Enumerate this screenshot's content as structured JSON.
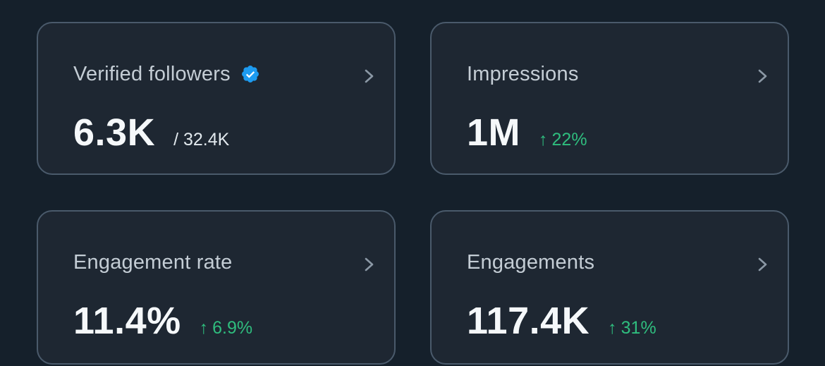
{
  "cards": [
    {
      "label": "Verified followers",
      "value": "6.3K",
      "total": "/ 32.4K",
      "verified_badge_icon": "verified-check-badge",
      "chevron_icon": "chevron-right"
    },
    {
      "label": "Impressions",
      "value": "1M",
      "delta_arrow": "↑",
      "delta": "22%",
      "chevron_icon": "chevron-right"
    },
    {
      "label": "Engagement rate",
      "value": "11.4%",
      "delta_arrow": "↑",
      "delta": "6.9%",
      "chevron_icon": "chevron-right"
    },
    {
      "label": "Engagements",
      "value": "117.4K",
      "delta_arrow": "↑",
      "delta": "31%",
      "chevron_icon": "chevron-right"
    }
  ],
  "colors": {
    "background": "#15202b",
    "card_background": "#1e2732",
    "card_border": "#4a5a6b",
    "verified_blue": "#1d9bf0",
    "positive_green": "#2fbd7e",
    "label_text": "#c4cdd5",
    "value_text": "#f5f8fa"
  }
}
